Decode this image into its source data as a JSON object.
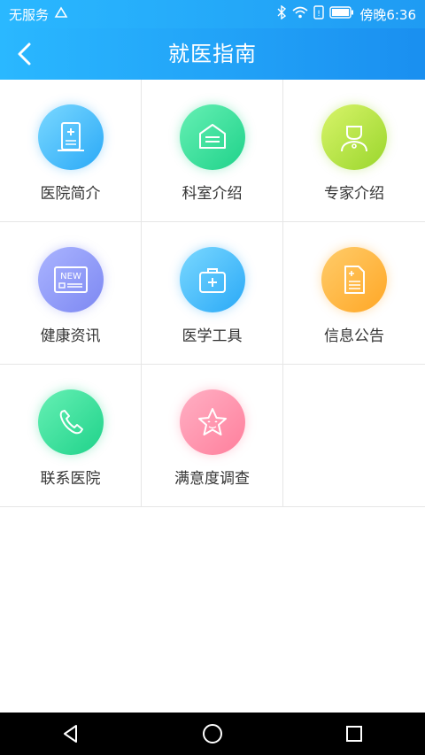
{
  "status_bar": {
    "carrier": "无服务",
    "time": "傍晚6:36",
    "icons": [
      "signal-icon",
      "bluetooth-icon",
      "wifi-icon",
      "sim-icon",
      "battery-icon"
    ]
  },
  "header": {
    "title": "就医指南",
    "back_icon": "chevron-left-icon"
  },
  "menu": [
    {
      "label": "医院简介",
      "icon": "hospital-building-icon",
      "color": "blue"
    },
    {
      "label": "科室介绍",
      "icon": "department-icon",
      "color": "green"
    },
    {
      "label": "专家介绍",
      "icon": "doctor-icon",
      "color": "lime"
    },
    {
      "label": "健康资讯",
      "icon": "news-icon",
      "color": "purple"
    },
    {
      "label": "医学工具",
      "icon": "medical-kit-icon",
      "color": "blue"
    },
    {
      "label": "信息公告",
      "icon": "notice-document-icon",
      "color": "orange"
    },
    {
      "label": "联系医院",
      "icon": "phone-icon",
      "color": "green"
    },
    {
      "label": "满意度调查",
      "icon": "star-icon",
      "color": "pink"
    }
  ],
  "system_nav": [
    "back-triangle-icon",
    "home-circle-icon",
    "recents-square-icon"
  ],
  "colors": {
    "accent": "#1f9bf3",
    "divider": "#e6e6e6",
    "text": "#333333"
  }
}
